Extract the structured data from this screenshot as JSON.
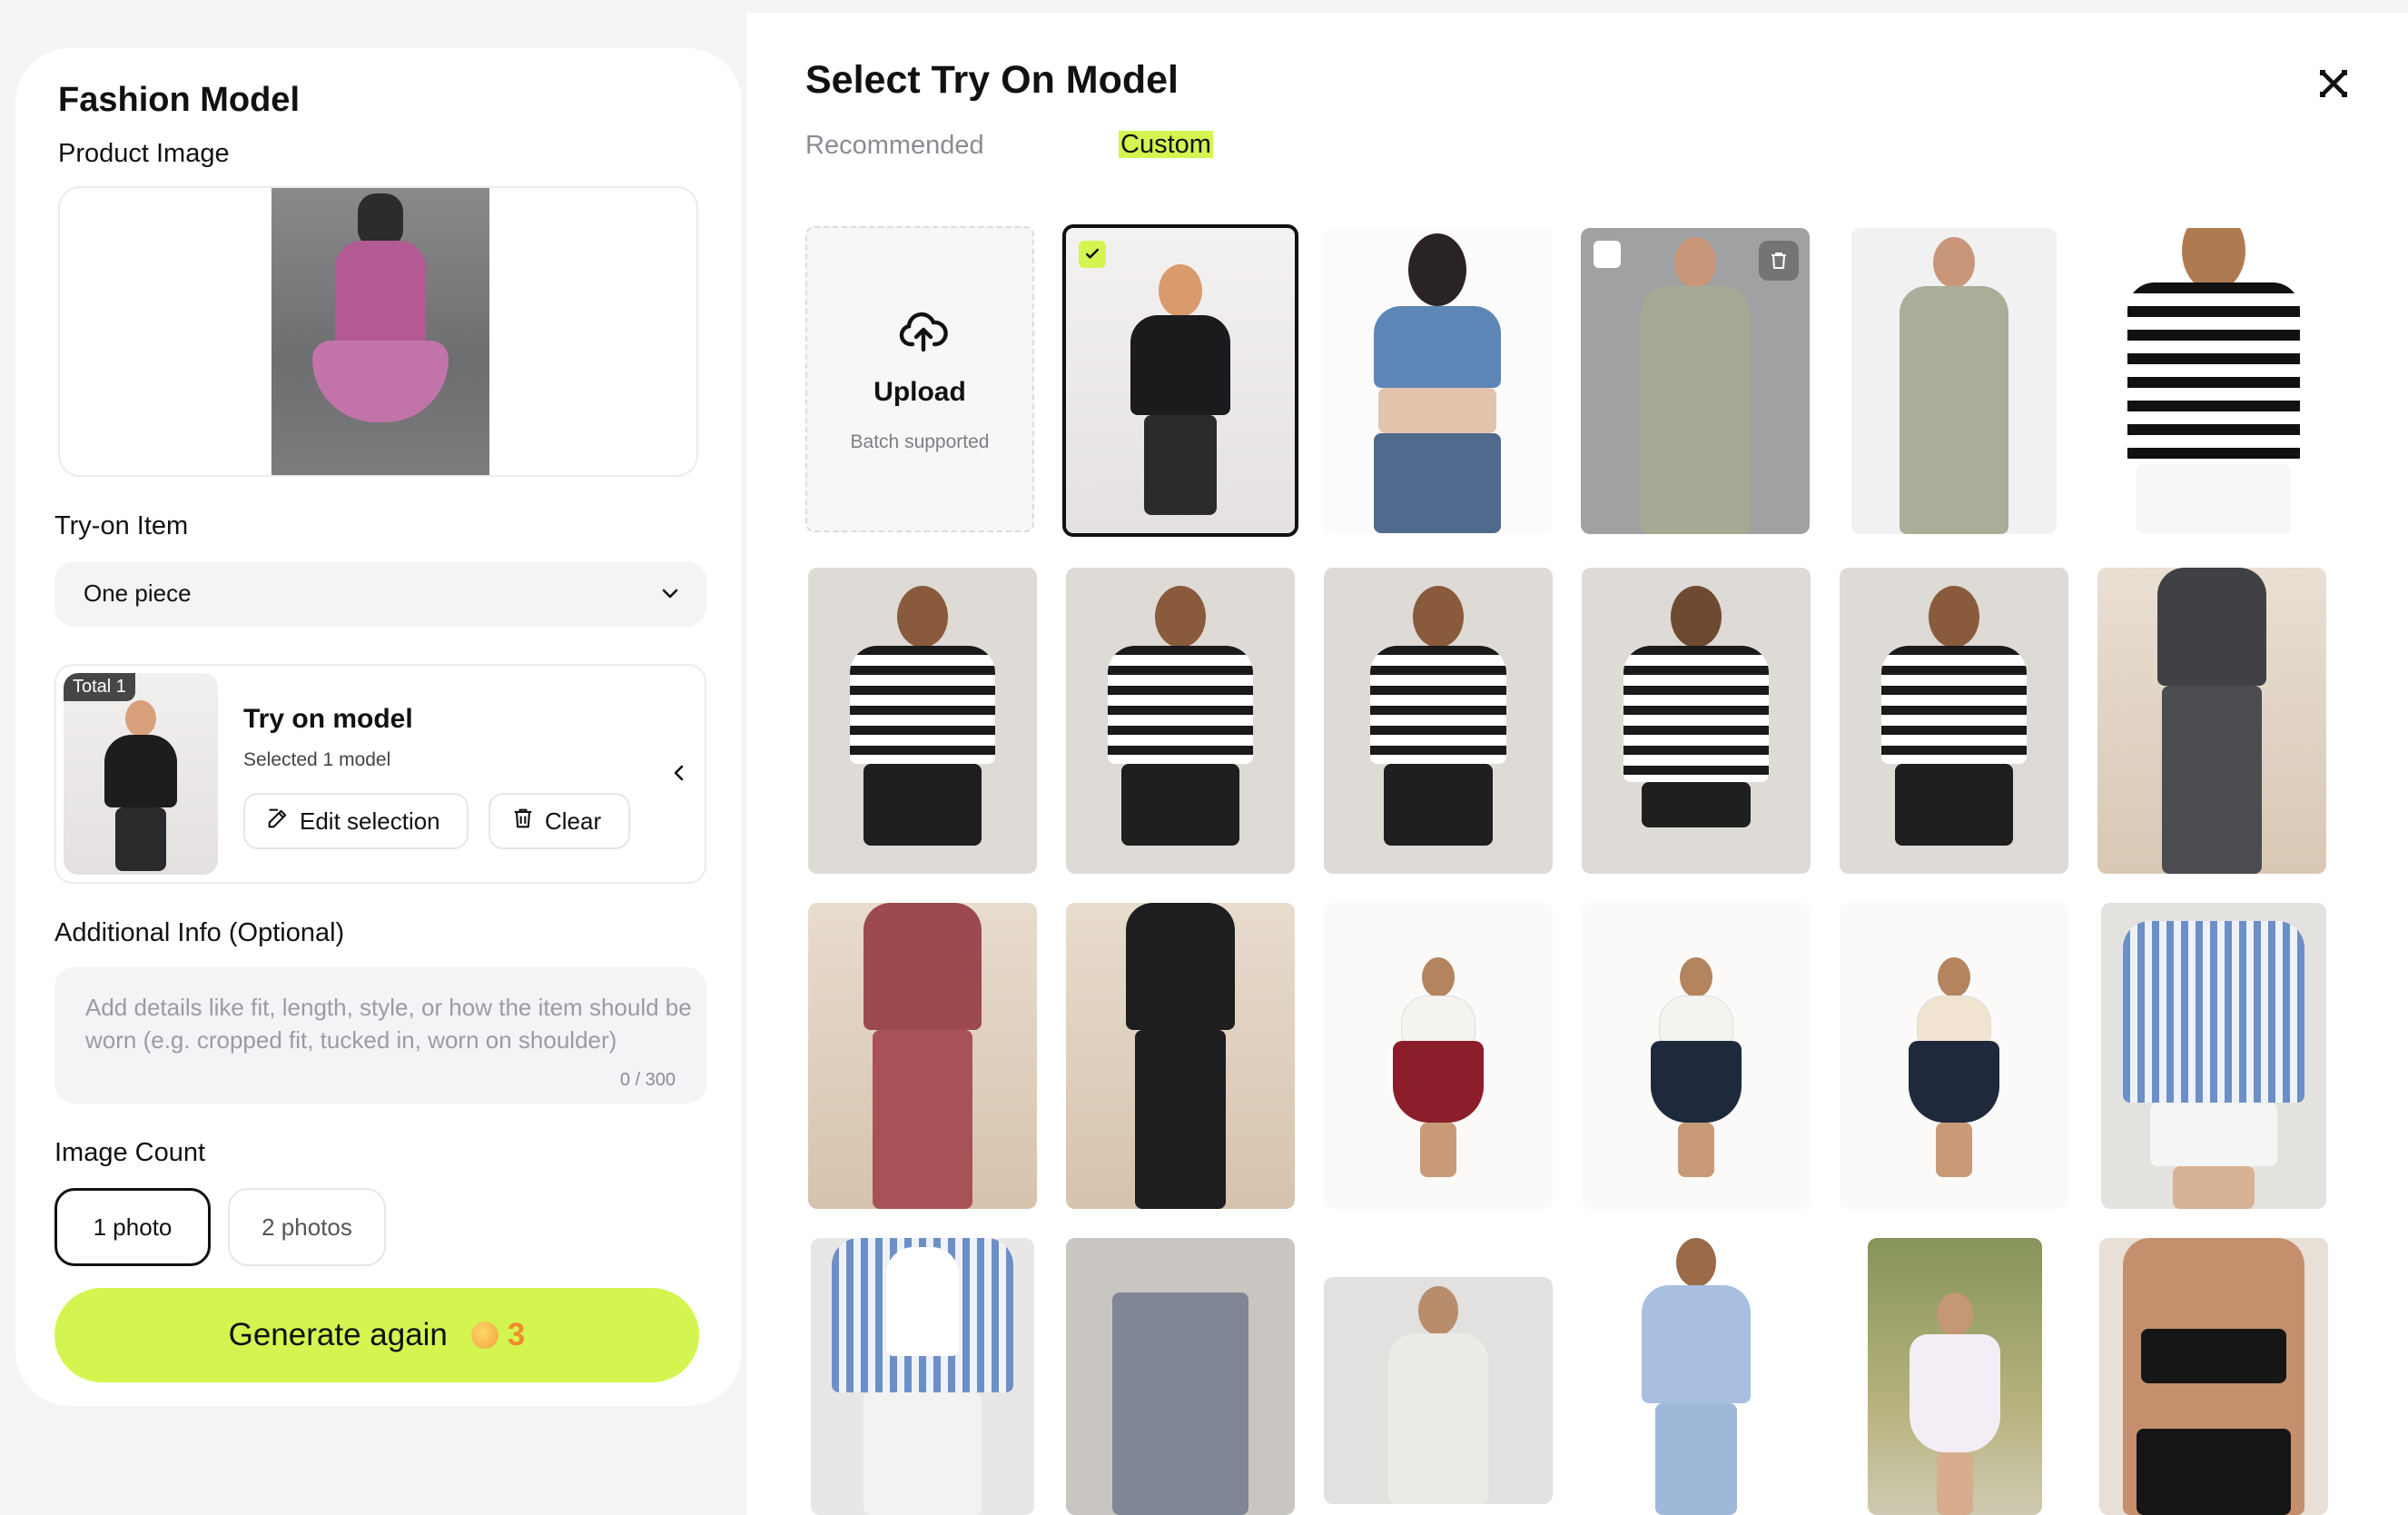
{
  "left_panel": {
    "title": "Fashion Model",
    "product_image_label": "Product Image",
    "tryon_item_label": "Try-on Item",
    "tryon_item_value": "One piece",
    "tryon_card": {
      "badge": "Total 1",
      "title": "Try on model",
      "subtitle": "Selected 1 model",
      "edit_label": "Edit selection",
      "clear_label": "Clear"
    },
    "additional_info_label": "Additional Info (Optional)",
    "additional_info_placeholder": "Add details like fit, length, style, or how the item should be worn (e.g. cropped fit, tucked in, worn on shoulder)",
    "additional_info_counter": "0 / 300",
    "image_count_label": "Image Count",
    "image_count_options": [
      "1 photo",
      "2 photos"
    ],
    "image_count_selected": "1 photo",
    "generate_label": "Generate again",
    "generate_cost": "3"
  },
  "modal": {
    "title": "Select Try On Model",
    "tabs": [
      "Recommended",
      "Custom"
    ],
    "active_tab": "Custom",
    "upload": {
      "label": "Upload",
      "sublabel": "Batch supported",
      "icon": "cloud-upload-icon"
    },
    "accent_color": "#d4f550"
  }
}
